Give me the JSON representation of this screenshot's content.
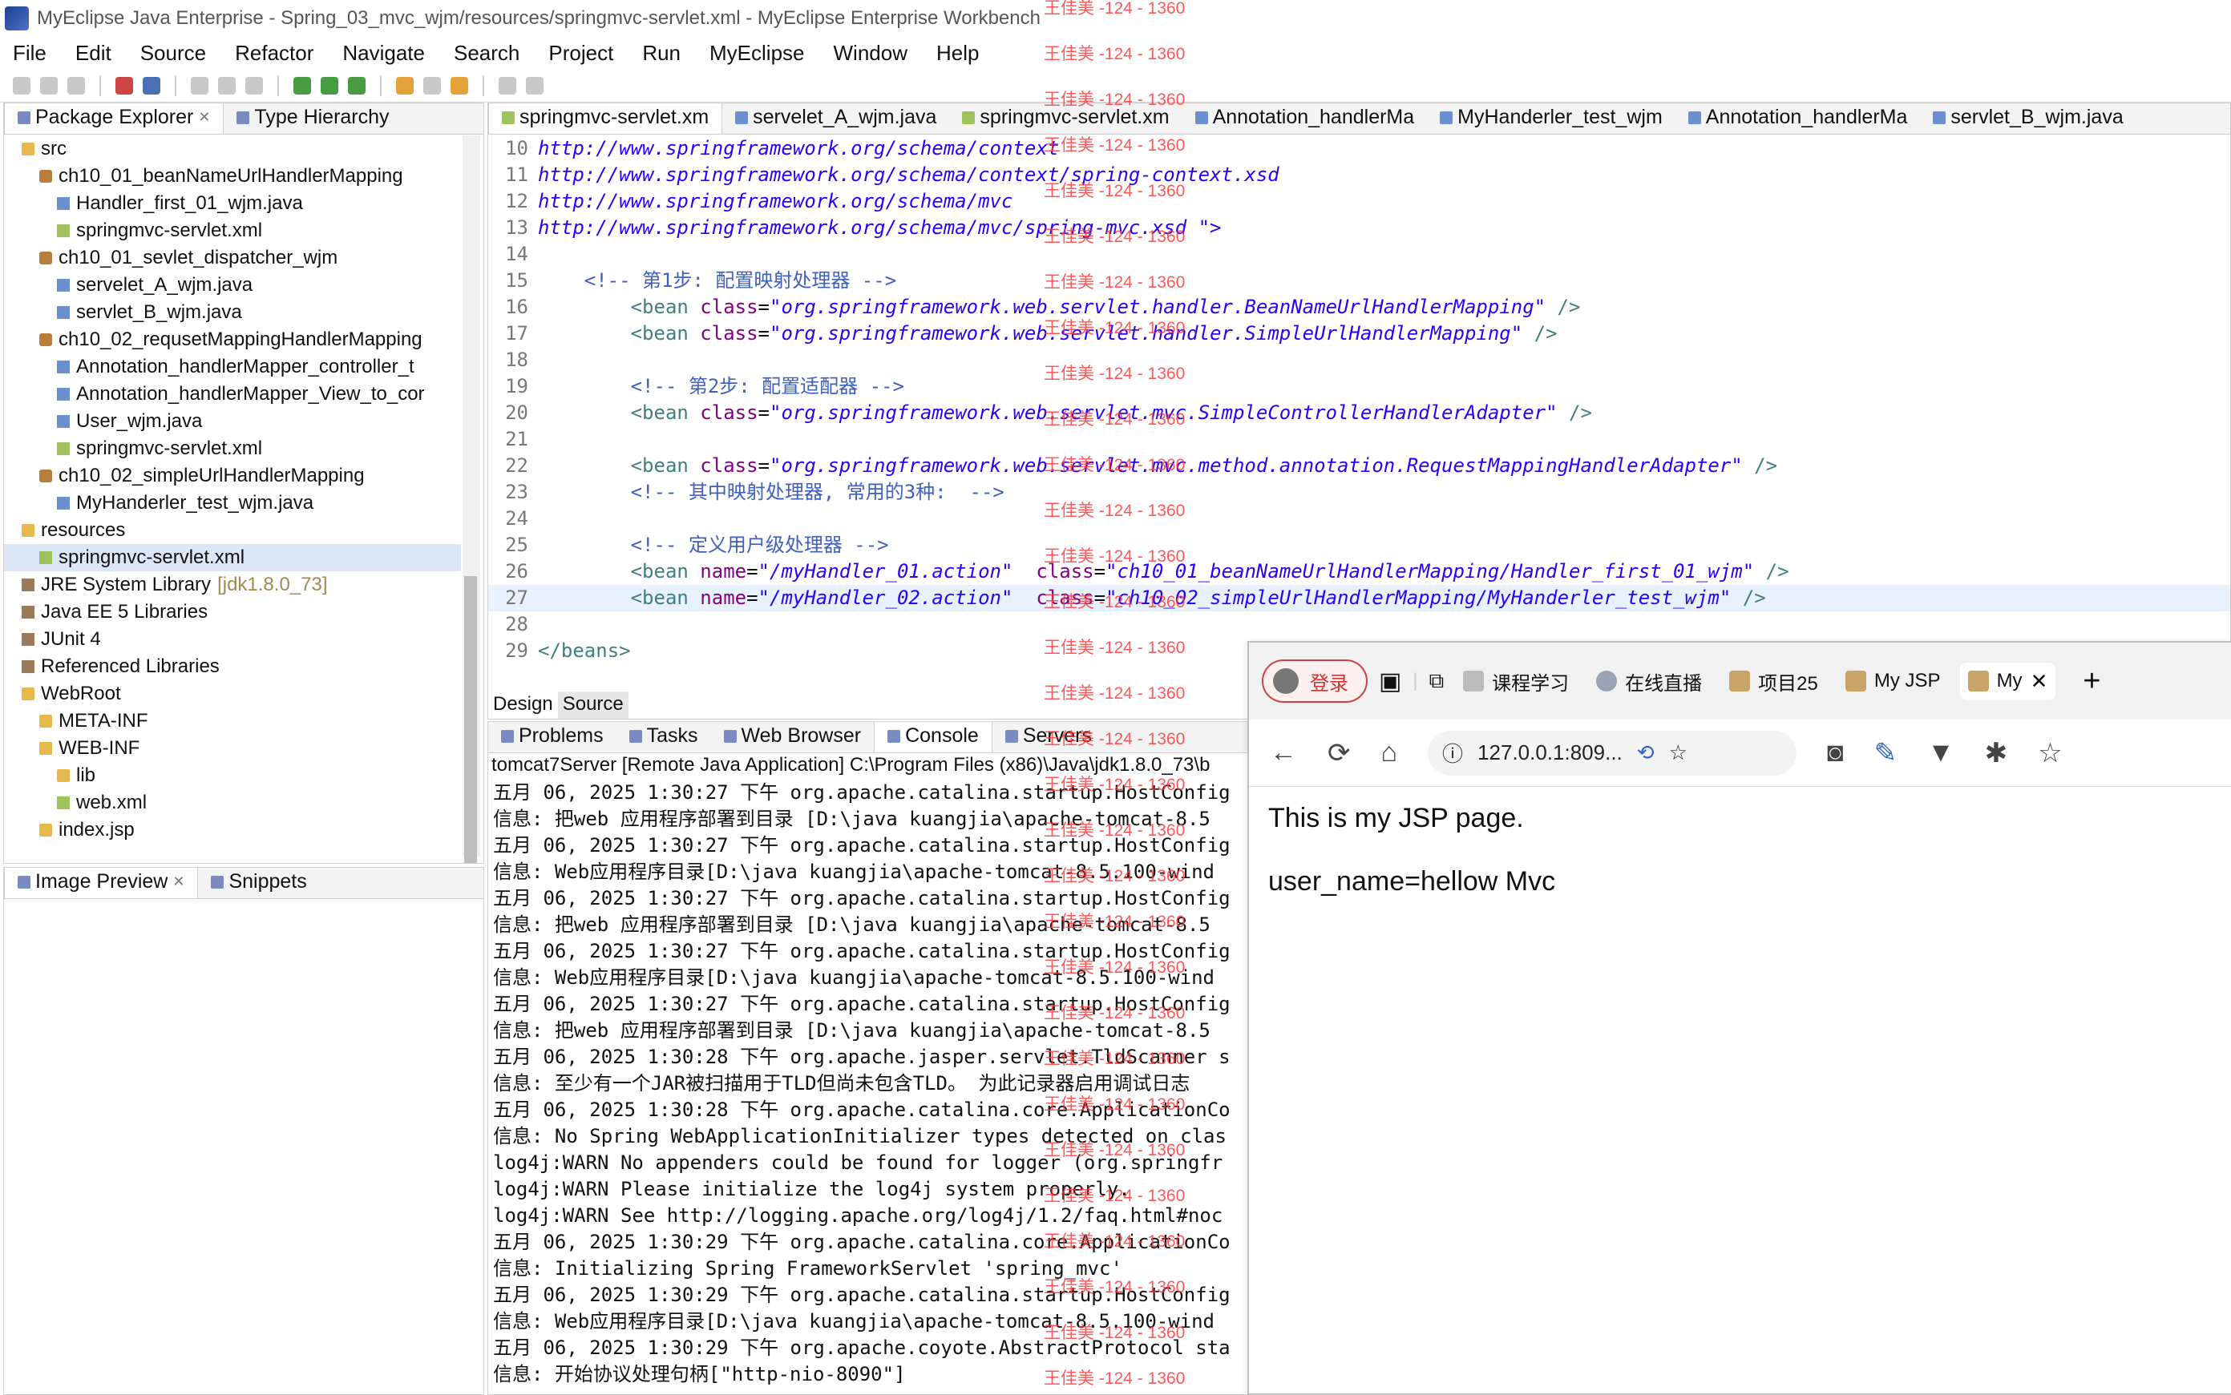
{
  "window": {
    "title": "MyEclipse Java Enterprise - Spring_03_mvc_wjm/resources/springmvc-servlet.xml - MyEclipse Enterprise Workbench"
  },
  "menu": [
    "File",
    "Edit",
    "Source",
    "Refactor",
    "Navigate",
    "Search",
    "Project",
    "Run",
    "MyEclipse",
    "Window",
    "Help"
  ],
  "left_tabs": {
    "package_explorer": "Package Explorer",
    "type_hierarchy": "Type Hierarchy"
  },
  "tree": [
    {
      "label": "src",
      "icon": "source-folder-icon",
      "indent": 1
    },
    {
      "label": "ch10_01_beanNameUrlHandlerMapping",
      "icon": "package-icon",
      "indent": 2
    },
    {
      "label": "Handler_first_01_wjm.java",
      "icon": "java-file-icon",
      "indent": 3
    },
    {
      "label": "springmvc-servlet.xml",
      "icon": "xml-file-icon",
      "indent": 3
    },
    {
      "label": "ch10_01_sevlet_dispatcher_wjm",
      "icon": "package-icon",
      "indent": 2
    },
    {
      "label": "servelet_A_wjm.java",
      "icon": "java-file-icon",
      "indent": 3
    },
    {
      "label": "servlet_B_wjm.java",
      "icon": "java-file-icon",
      "indent": 3
    },
    {
      "label": "ch10_02_requsetMappingHandlerMapping",
      "icon": "package-icon",
      "indent": 2
    },
    {
      "label": "Annotation_handlerMapper_controller_t",
      "icon": "java-file-icon",
      "indent": 3
    },
    {
      "label": "Annotation_handlerMapper_View_to_cor",
      "icon": "java-file-icon",
      "indent": 3
    },
    {
      "label": "User_wjm.java",
      "icon": "java-file-icon",
      "indent": 3
    },
    {
      "label": "springmvc-servlet.xml",
      "icon": "xml-file-icon",
      "indent": 3
    },
    {
      "label": "ch10_02_simpleUrlHandlerMapping",
      "icon": "package-icon",
      "indent": 2
    },
    {
      "label": "MyHanderler_test_wjm.java",
      "icon": "java-file-icon",
      "indent": 3
    },
    {
      "label": "resources",
      "icon": "folder-icon",
      "indent": 1
    },
    {
      "label": "springmvc-servlet.xml",
      "icon": "xml-file-icon",
      "indent": 2,
      "selected": true
    },
    {
      "label": "JRE System Library",
      "suffix": "[jdk1.8.0_73]",
      "icon": "library-icon",
      "indent": 1
    },
    {
      "label": "Java EE 5 Libraries",
      "icon": "library-icon",
      "indent": 1
    },
    {
      "label": "JUnit 4",
      "icon": "library-icon",
      "indent": 1
    },
    {
      "label": "Referenced Libraries",
      "icon": "library-icon",
      "indent": 1
    },
    {
      "label": "WebRoot",
      "icon": "folder-icon",
      "indent": 1
    },
    {
      "label": "META-INF",
      "icon": "folder-icon",
      "indent": 2
    },
    {
      "label": "WEB-INF",
      "icon": "folder-icon",
      "indent": 2
    },
    {
      "label": "lib",
      "icon": "folder-icon",
      "indent": 3
    },
    {
      "label": "web.xml",
      "icon": "xml-file-icon",
      "indent": 3
    },
    {
      "label": "index.jsp",
      "icon": "jsp-file-icon",
      "indent": 2
    }
  ],
  "bottom_left_tabs": {
    "image_preview": "Image Preview",
    "snippets": "Snippets"
  },
  "editor_tabs": [
    "springmvc-servlet.xm",
    "servelet_A_wjm.java",
    "springmvc-servlet.xm",
    "Annotation_handlerMa",
    "MyHanderler_test_wjm",
    "Annotation_handlerMa",
    "servlet_B_wjm.java"
  ],
  "editor_bottom_tabs": {
    "design": "Design",
    "source": "Source"
  },
  "code_lines": [
    {
      "n": "10",
      "parts": [
        [
          "url",
          "http://www.springframework.org/schema/context"
        ]
      ]
    },
    {
      "n": "11",
      "parts": [
        [
          "url",
          "http://www.springframework.org/schema/context/spring-context.xsd"
        ]
      ]
    },
    {
      "n": "12",
      "parts": [
        [
          "url",
          "http://www.springframework.org/schema/mvc"
        ]
      ]
    },
    {
      "n": "13",
      "parts": [
        [
          "url",
          "http://www.springframework.org/schema/mvc/spring-mvc.xsd"
        ],
        [
          "val",
          " \">"
        ]
      ]
    },
    {
      "n": "14",
      "parts": []
    },
    {
      "n": "15",
      "parts": [
        [
          "txt",
          "    "
        ],
        [
          "cmt",
          "<!-- 第1步: 配置映射处理器 -->"
        ]
      ]
    },
    {
      "n": "16",
      "parts": [
        [
          "txt",
          "        "
        ],
        [
          "tag",
          "<bean "
        ],
        [
          "attr",
          "class"
        ],
        [
          "txt",
          "="
        ],
        [
          "val",
          "\"org.springframework.web.servlet.handler.BeanNameUrlHandlerMapping\""
        ],
        [
          "tag",
          " />"
        ]
      ]
    },
    {
      "n": "17",
      "parts": [
        [
          "txt",
          "        "
        ],
        [
          "tag",
          "<bean "
        ],
        [
          "attr",
          "class"
        ],
        [
          "txt",
          "="
        ],
        [
          "val",
          "\"org.springframework.web.servlet.handler.SimpleUrlHandlerMapping\""
        ],
        [
          "tag",
          " />"
        ]
      ]
    },
    {
      "n": "18",
      "parts": []
    },
    {
      "n": "19",
      "parts": [
        [
          "txt",
          "        "
        ],
        [
          "cmt",
          "<!-- 第2步: 配置适配器 -->"
        ]
      ]
    },
    {
      "n": "20",
      "parts": [
        [
          "txt",
          "        "
        ],
        [
          "tag",
          "<bean "
        ],
        [
          "attr",
          "class"
        ],
        [
          "txt",
          "="
        ],
        [
          "val",
          "\"org.springframework.web.servlet.mvc.SimpleControllerHandlerAdapter\""
        ],
        [
          "tag",
          " />"
        ]
      ]
    },
    {
      "n": "21",
      "parts": []
    },
    {
      "n": "22",
      "parts": [
        [
          "txt",
          "        "
        ],
        [
          "tag",
          "<bean "
        ],
        [
          "attr",
          "class"
        ],
        [
          "txt",
          "="
        ],
        [
          "val",
          "\"org.springframework.web.servlet.mvc.method.annotation.RequestMappingHandlerAdapter\""
        ],
        [
          "tag",
          " />"
        ]
      ]
    },
    {
      "n": "23",
      "parts": [
        [
          "txt",
          "        "
        ],
        [
          "cmt",
          "<!-- 其中映射处理器, 常用的3种:  -->"
        ]
      ]
    },
    {
      "n": "24",
      "parts": []
    },
    {
      "n": "25",
      "parts": [
        [
          "txt",
          "        "
        ],
        [
          "cmt",
          "<!-- 定义用户级处理器 -->"
        ]
      ]
    },
    {
      "n": "26",
      "parts": [
        [
          "txt",
          "        "
        ],
        [
          "tag",
          "<bean "
        ],
        [
          "attr",
          "name"
        ],
        [
          "txt",
          "="
        ],
        [
          "val",
          "\"/myHandler_01.action\""
        ],
        [
          "txt",
          "  "
        ],
        [
          "attr",
          "class"
        ],
        [
          "txt",
          "="
        ],
        [
          "val",
          "\"ch10_01_beanNameUrlHandlerMapping/Handler_first_01_wjm\""
        ],
        [
          "tag",
          " />"
        ]
      ]
    },
    {
      "n": "27",
      "parts": [
        [
          "txt",
          "        "
        ],
        [
          "tag",
          "<bean "
        ],
        [
          "attr",
          "name"
        ],
        [
          "txt",
          "="
        ],
        [
          "val",
          "\"/myHandler_02.action\""
        ],
        [
          "txt",
          "  "
        ],
        [
          "attr",
          "class"
        ],
        [
          "txt",
          "="
        ],
        [
          "val",
          "\"ch10_02_simpleUrlHandlerMapping/MyHanderler_test_wjm\""
        ],
        [
          "tag",
          " />"
        ]
      ],
      "current": true
    },
    {
      "n": "28",
      "parts": []
    },
    {
      "n": "29",
      "parts": [
        [
          "tag",
          "</beans>"
        ]
      ]
    }
  ],
  "console_tabs": [
    "Problems",
    "Tasks",
    "Web Browser",
    "Console",
    "Servers"
  ],
  "console_header": "tomcat7Server [Remote Java Application] C:\\Program Files (x86)\\Java\\jdk1.8.0_73\\b",
  "console_lines": [
    "五月 06, 2025 1:30:27 下午 org.apache.catalina.startup.HostConfig",
    "信息: 把web 应用程序部署到目录 [D:\\java kuangjia\\apache-tomcat-8.5",
    "五月 06, 2025 1:30:27 下午 org.apache.catalina.startup.HostConfig",
    "信息: Web应用程序目录[D:\\java kuangjia\\apache-tomcat-8.5.100-wind",
    "五月 06, 2025 1:30:27 下午 org.apache.catalina.startup.HostConfig",
    "信息: 把web 应用程序部署到目录 [D:\\java kuangjia\\apache-tomcat-8.5",
    "五月 06, 2025 1:30:27 下午 org.apache.catalina.startup.HostConfig",
    "信息: Web应用程序目录[D:\\java kuangjia\\apache-tomcat-8.5.100-wind",
    "五月 06, 2025 1:30:27 下午 org.apache.catalina.startup.HostConfig",
    "信息: 把web 应用程序部署到目录 [D:\\java kuangjia\\apache-tomcat-8.5",
    "五月 06, 2025 1:30:28 下午 org.apache.jasper.servlet.TldScanner s",
    "信息: 至少有一个JAR被扫描用于TLD但尚未包含TLD。 为此记录器启用调试日志",
    "五月 06, 2025 1:30:28 下午 org.apache.catalina.core.ApplicationCo",
    "信息: No Spring WebApplicationInitializer types detected on clas",
    "log4j:WARN No appenders could be found for logger (org.springfr",
    "log4j:WARN Please initialize the log4j system properly.",
    "log4j:WARN See http://logging.apache.org/log4j/1.2/faq.html#noc",
    "五月 06, 2025 1:30:29 下午 org.apache.catalina.core.ApplicationCo",
    "信息: Initializing Spring FrameworkServlet 'spring_mvc'",
    "五月 06, 2025 1:30:29 下午 org.apache.catalina.startup.HostConfig",
    "信息: Web应用程序目录[D:\\java kuangjia\\apache-tomcat-8.5.100-wind",
    "五月 06, 2025 1:30:29 下午 org.apache.coyote.AbstractProtocol sta",
    "信息: 开始协议处理句柄[\"http-nio-8090\"]"
  ],
  "browser": {
    "login_label": "登录",
    "tabs": [
      "课程学习",
      "在线直播",
      "项目25",
      "My JSP",
      "My"
    ],
    "address": "127.0.0.1:809...",
    "content_line1": "This is my JSP page.",
    "content_line2": "user_name=hellow Mvc"
  },
  "watermark": "王佳美 -124 - 1360"
}
